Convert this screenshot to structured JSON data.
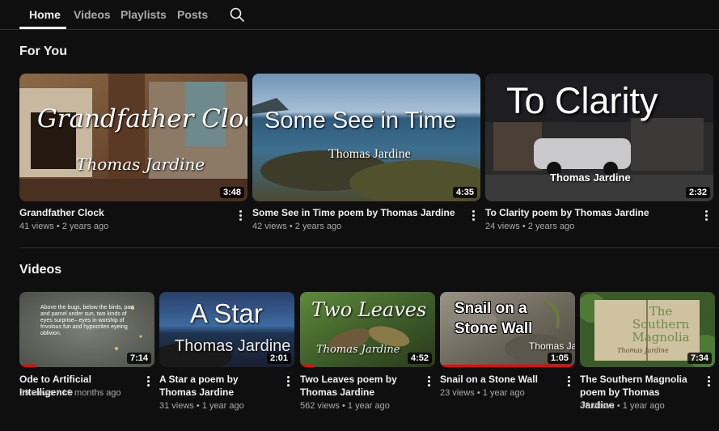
{
  "tabs": [
    {
      "label": "Home"
    },
    {
      "label": "Videos"
    },
    {
      "label": "Playlists"
    },
    {
      "label": "Posts"
    }
  ],
  "search_icon": "search-icon",
  "sections": {
    "for_you": {
      "title": "For You",
      "videos": [
        {
          "thumb_text": "Grandfather Clock",
          "thumb_sub": "Thomas Jardine",
          "duration": "3:48",
          "title": "Grandfather Clock",
          "views": "41 views",
          "age": "2 years ago"
        },
        {
          "thumb_text": "Some See in Time",
          "thumb_sub": "Thomas Jardine",
          "duration": "4:35",
          "title": "Some See in Time   poem by Thomas Jardine",
          "views": "42 views",
          "age": "2 years ago"
        },
        {
          "thumb_text": "To Clarity",
          "thumb_sub": "Thomas Jardine",
          "duration": "2:32",
          "title": "To Clarity     poem by Thomas Jardine",
          "views": "24 views",
          "age": "2 years ago"
        }
      ]
    },
    "videos": {
      "title": "Videos",
      "videos": [
        {
          "thumb_text": "Above the bugs, below the birds, part and parcel under sun, two kinds of eyes surprise– eyes in worship of frivolous fun and hypocrites eyeing oblivion.",
          "duration": "7:14",
          "progress": 0.12,
          "title": "Ode to Artificial Intelligence",
          "views": "39 views",
          "age": "10 months ago"
        },
        {
          "thumb_text": "A Star",
          "thumb_sub": "Thomas Jardine",
          "duration": "2:01",
          "title": "A Star   a poem by Thomas Jardine",
          "views": "31 views",
          "age": "1 year ago"
        },
        {
          "thumb_text": "Two Leaves",
          "thumb_sub": "Thomas Jardine",
          "duration": "4:52",
          "progress": 0.1,
          "title": "Two Leaves   poem by Thomas Jardine",
          "views": "562 views",
          "age": "1 year ago"
        },
        {
          "thumb_text": "Snail on a Stone Wall",
          "thumb_sub": "Thomas Jar",
          "duration": "1:05",
          "progress": 1.0,
          "title": "Snail on a Stone Wall",
          "views": "23 views",
          "age": "1 year ago"
        },
        {
          "thumb_text": "The Southern Magnolia",
          "thumb_sub": "Thomas Jardine",
          "duration": "7:34",
          "title": "The Southern Magnolia poem by Thomas Jardine",
          "views": "38 views",
          "age": "1 year ago"
        }
      ]
    }
  },
  "kebab_icon": "more-vertical-icon"
}
